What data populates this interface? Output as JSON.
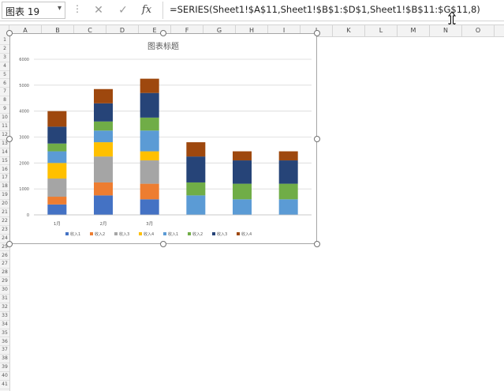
{
  "formula_bar": {
    "name_box": "图表 19",
    "cancel_icon": "close-icon",
    "enter_icon": "check-icon",
    "function_label": "fx",
    "formula": "=SERIES(Sheet1!$A$11,Sheet1!$B$1:$D$1,Sheet1!$B$11:$G$11,8)"
  },
  "columns": [
    "A",
    "B",
    "C",
    "D",
    "E",
    "F",
    "G",
    "H",
    "I",
    "J",
    "K",
    "L",
    "M",
    "N",
    "O"
  ],
  "rows": [
    "1",
    "2",
    "3",
    "4",
    "5",
    "6",
    "7",
    "8",
    "9",
    "10",
    "11",
    "12",
    "13",
    "14",
    "15",
    "16",
    "17",
    "18",
    "19",
    "20",
    "21",
    "22",
    "23",
    "24",
    "25",
    "26",
    "27",
    "28",
    "29",
    "30",
    "31",
    "32",
    "33",
    "34",
    "35",
    "36",
    "37",
    "38",
    "39",
    "40",
    "41"
  ],
  "chart_data": {
    "type": "bar",
    "stacked": true,
    "title": "图表标题",
    "categories": [
      "1月",
      "2月",
      "3月",
      "",
      "",
      ""
    ],
    "y_ticks": [
      "0",
      "1000",
      "2000",
      "3000",
      "4000",
      "5000",
      "6000"
    ],
    "ylim": [
      0,
      6000
    ],
    "grid": true,
    "legend_position": "bottom",
    "series": [
      {
        "name": "收入1",
        "color": "#4472c4",
        "values": [
          400,
          750,
          600,
          0,
          0,
          0
        ]
      },
      {
        "name": "收入2",
        "color": "#ed7d31",
        "values": [
          300,
          500,
          600,
          0,
          0,
          0
        ]
      },
      {
        "name": "收入3",
        "color": "#a5a5a5",
        "values": [
          700,
          1000,
          900,
          0,
          0,
          0
        ]
      },
      {
        "name": "收入4",
        "color": "#ffc000",
        "values": [
          600,
          550,
          350,
          0,
          0,
          0
        ]
      },
      {
        "name": "收入1",
        "color": "#5b9bd5",
        "values": [
          450,
          450,
          800,
          750,
          600,
          600
        ]
      },
      {
        "name": "收入2",
        "color": "#70ad47",
        "values": [
          300,
          350,
          500,
          500,
          600,
          600
        ]
      },
      {
        "name": "收入3",
        "color": "#264478",
        "values": [
          650,
          700,
          950,
          1000,
          900,
          900
        ]
      },
      {
        "name": "收入4",
        "color": "#9e480e",
        "values": [
          600,
          550,
          550,
          550,
          350,
          350
        ]
      }
    ]
  }
}
